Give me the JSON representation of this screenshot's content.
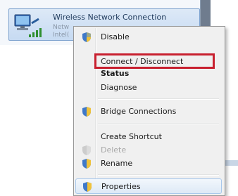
{
  "network": {
    "title": "Wireless Network Connection",
    "status_line": "Netw",
    "adapter_line": "Intel("
  },
  "context_menu": {
    "items": [
      {
        "label": "Disable",
        "icon": "shield-icon"
      },
      {
        "label": "Connect / Disconnect",
        "icon": ""
      },
      {
        "label": "Status",
        "icon": ""
      },
      {
        "label": "Diagnose",
        "icon": ""
      },
      {
        "label": "Bridge Connections",
        "icon": "shield-icon"
      },
      {
        "label": "Create Shortcut",
        "icon": ""
      },
      {
        "label": "Delete",
        "icon": "shield-icon"
      },
      {
        "label": "Rename",
        "icon": "shield-icon"
      },
      {
        "label": "Properties",
        "icon": "shield-icon"
      }
    ],
    "highlighted_item": "Connect / Disconnect",
    "highlight_color": "#c8202f"
  }
}
